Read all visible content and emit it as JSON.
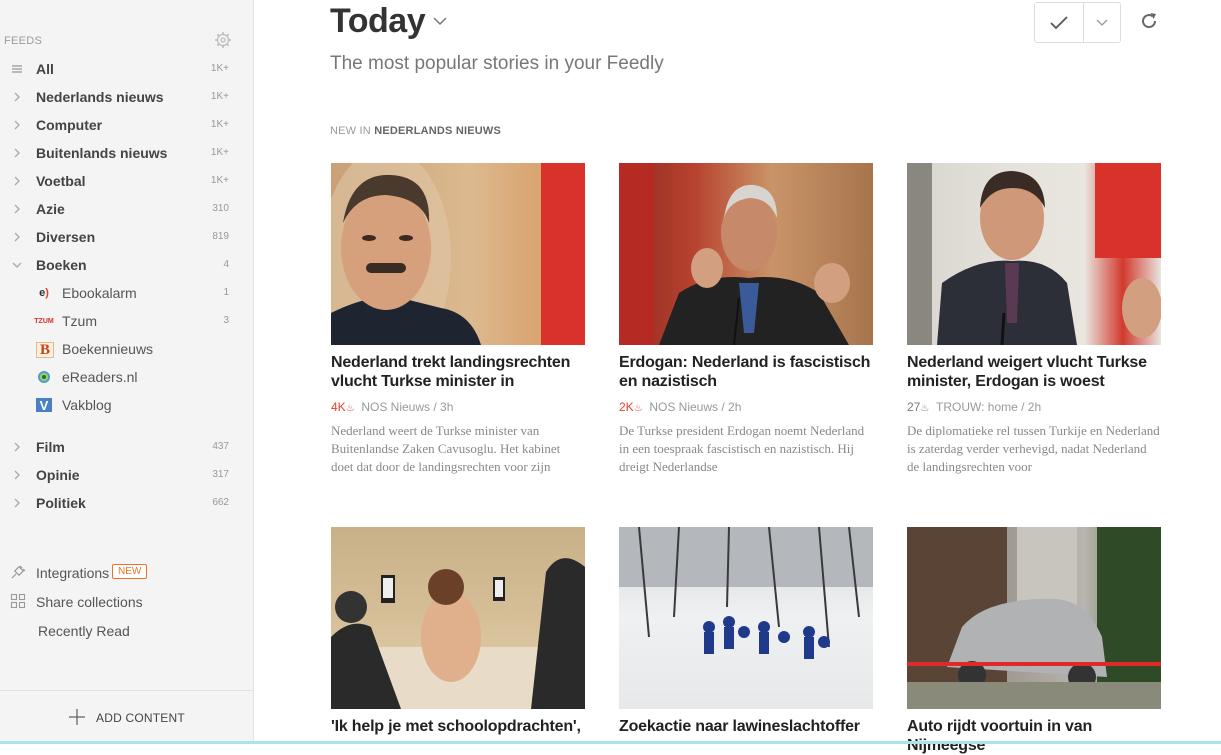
{
  "sidebar": {
    "feeds_label": "FEEDS",
    "items": [
      {
        "label": "All",
        "count": "1K+",
        "icon": "list-icon"
      },
      {
        "label": "Nederlands nieuws",
        "count": "1K+",
        "icon": "chevron-right-icon"
      },
      {
        "label": "Computer",
        "count": "1K+",
        "icon": "chevron-right-icon"
      },
      {
        "label": "Buitenlands nieuws",
        "count": "1K+",
        "icon": "chevron-right-icon"
      },
      {
        "label": "Voetbal",
        "count": "1K+",
        "icon": "chevron-right-icon"
      },
      {
        "label": "Azie",
        "count": "310",
        "icon": "chevron-right-icon"
      },
      {
        "label": "Diversen",
        "count": "819",
        "icon": "chevron-right-icon"
      },
      {
        "label": "Boeken",
        "count": "4",
        "icon": "chevron-down-icon"
      }
    ],
    "sub_items": [
      {
        "label": "Ebookalarm",
        "count": "1",
        "favicon": "e)"
      },
      {
        "label": "Tzum",
        "count": "3",
        "favicon": "TZUM"
      },
      {
        "label": "Boekennieuws",
        "count": "",
        "favicon": "B"
      },
      {
        "label": "eReaders.nl",
        "count": "",
        "favicon": "◉"
      },
      {
        "label": "Vakblog",
        "count": "",
        "favicon": "V"
      }
    ],
    "more_items": [
      {
        "label": "Film",
        "count": "437"
      },
      {
        "label": "Opinie",
        "count": "317"
      },
      {
        "label": "Politiek",
        "count": "662"
      }
    ],
    "integrations_label": "Integrations",
    "new_badge": "NEW",
    "share_label": "Share collections",
    "recent_label": "Recently Read",
    "add_content_label": "ADD CONTENT"
  },
  "main": {
    "title": "Today",
    "subtitle": "The most popular stories in your Feedly",
    "section_prefix": "NEW IN",
    "section_name": "NEDERLANDS NIEUWS",
    "cards": [
      {
        "title": "Nederland trekt landingsrechten vlucht Turkse minister in",
        "popularity": "4K",
        "source": "NOS Nieuws / 3h",
        "excerpt": "Nederland weert de Turkse minister van Buitenlandse Zaken Cavusoglu. Het kabinet doet dat door de landingsrechten voor zijn"
      },
      {
        "title": "Erdogan: Nederland is fascistisch en nazistisch",
        "popularity": "2K",
        "source": "NOS Nieuws / 2h",
        "excerpt": "De Turkse president Erdogan noemt Nederland in een toespraak fascistisch en nazistisch. Hij dreigt Nederlandse"
      },
      {
        "title": "Nederland weigert vlucht Turkse minister, Erdogan is woest",
        "popularity": "27",
        "source": "TROUW: home / 2h",
        "excerpt": "De diplomatieke rel tussen Turkije en Nederland is zaterdag verder verhevigd, nadat Nederland de landingsrechten voor"
      },
      {
        "title": "'Ik help je met schoolopdrachten',",
        "popularity": "",
        "source": "",
        "excerpt": ""
      },
      {
        "title": "Zoekactie naar lawineslachtoffer",
        "popularity": "",
        "source": "",
        "excerpt": ""
      },
      {
        "title": "Auto rijdt voortuin in van Nijmeegse",
        "popularity": "",
        "source": "",
        "excerpt": ""
      }
    ]
  },
  "colors": {
    "accent": "#e8742a",
    "hot": "#e8402a",
    "sidebar_bg": "#f4f4f4"
  }
}
